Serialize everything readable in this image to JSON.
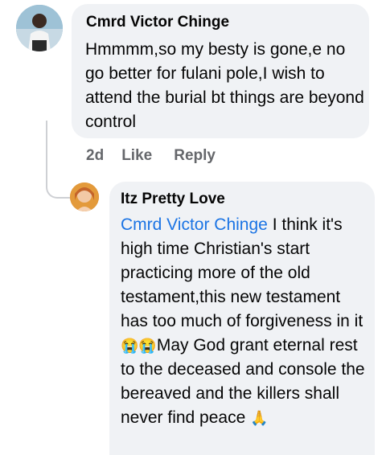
{
  "comment": {
    "author": "Cmrd Victor Chinge",
    "text": "Hmmmm,so my besty is gone,e no go better for fulani pole,I wish to attend the burial bt things are beyond control",
    "time": "2d",
    "like_label": "Like",
    "reply_label": "Reply"
  },
  "reply": {
    "author": "Itz Pretty Love",
    "mention": "Cmrd Victor Chinge",
    "text_part1": " I think it's high time Christian's start practicing more of the old testament,this new testament has too much of forgiveness in it ",
    "emoji1": "😭😭",
    "text_part2": "May God grant eternal rest to the deceased and console the bereaved and the killers shall never find peace ",
    "emoji2": "🙏"
  }
}
